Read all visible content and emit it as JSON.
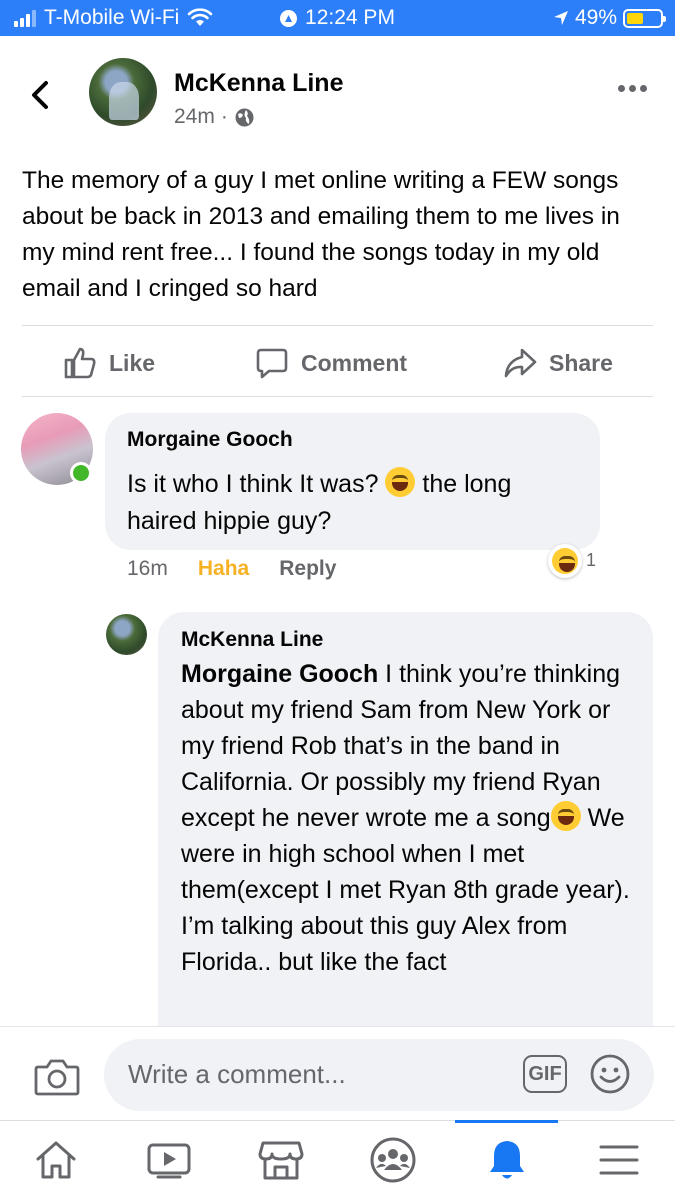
{
  "status_bar": {
    "carrier": "T-Mobile Wi-Fi",
    "time": "12:24 PM",
    "battery": "49%",
    "battery_level": 0.49
  },
  "post": {
    "author": "McKenna Line",
    "time_ago": "24m",
    "separator": "·",
    "text": "The memory of a guy I met online writing a FEW songs about be back in 2013 and emailing them to me lives in my mind rent free... I found the songs today in my old email and I cringed so hard"
  },
  "actions": {
    "like": "Like",
    "comment": "Comment",
    "share": "Share"
  },
  "comments": [
    {
      "author": "Morgaine Gooch",
      "text_before": "Is it who I think It was? ",
      "text_after": " the long haired hippie guy?",
      "time": "16m",
      "reaction_label": "Haha",
      "reply_label": "Reply",
      "reaction_count": "1"
    },
    {
      "author": "McKenna Line",
      "mention": "Morgaine Gooch",
      "text_before": " I think you’re thinking about my friend Sam from New York or my friend Rob that’s in the band in California. Or possibly my friend Ryan except he never wrote me a song",
      "text_after": " We were in high school when I met them(except I met Ryan 8th grade year). I’m talking about this guy Alex from Florida.. but like the fact"
    }
  ],
  "composer": {
    "placeholder": "Write a comment...",
    "gif": "GIF"
  },
  "icons": {
    "back": "chevron-left-icon",
    "more": "more-horizontal-icon",
    "globe": "globe-icon",
    "like": "thumbs-up-icon",
    "comment": "comment-bubble-icon",
    "share": "share-arrow-icon",
    "camera": "camera-icon",
    "emoji": "smiley-icon",
    "nav": [
      "home-icon",
      "video-icon",
      "marketplace-icon",
      "groups-icon",
      "notifications-bell-icon",
      "menu-icon"
    ]
  },
  "colors": {
    "status_bar": "#2d7ff9",
    "accent": "#1877f2",
    "haha": "#f7b125",
    "online": "#42b72a",
    "bubble": "#f0f2f5"
  }
}
